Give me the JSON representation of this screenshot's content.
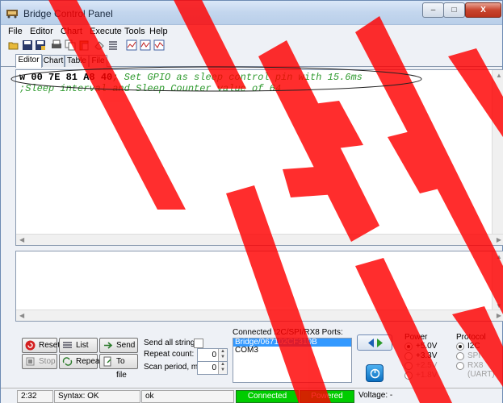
{
  "window": {
    "title": "Bridge Control Panel",
    "min_label": "–",
    "max_label": "□",
    "close_label": "X"
  },
  "menu": [
    {
      "label": "File"
    },
    {
      "label": "Editor"
    },
    {
      "label": "Chart"
    },
    {
      "label": "Execute"
    },
    {
      "label": "Tools"
    },
    {
      "label": "Help"
    }
  ],
  "toolbar": {
    "icons": [
      "open-icon",
      "save-icon",
      "save-as-icon",
      "print-icon",
      "copy-icon",
      "paste-icon",
      "clear-icon",
      "list-icon",
      "chart-1-icon",
      "chart-2-icon",
      "chart-3-icon"
    ]
  },
  "tabs": [
    {
      "label": "Editor",
      "active": true
    },
    {
      "label": "Chart"
    },
    {
      "label": "Table"
    },
    {
      "label": "File"
    }
  ],
  "editor": {
    "line1_cmd": "w 00 7E 81 A8 40",
    "line1_comment": "; Set GPIO as sleep control pin with 15.6ms",
    "line2_comment": ";Sleep interval and Sleep Counter value of 64"
  },
  "buttons": {
    "reset": "Reset",
    "list": "List",
    "send": "Send",
    "stop": "Stop",
    "repeat": "Repeat",
    "to_file": "To file"
  },
  "options": {
    "send_all_label": "Send all strings:",
    "repeat_count_label": "Repeat count:",
    "repeat_count_value": "0",
    "scan_period_label": "Scan period, ms:",
    "scan_period_value": "0"
  },
  "ports": {
    "label": "Connected I2C/SPI/RX8 Ports:",
    "items": [
      "Bridge/067102CF310B",
      "COM3"
    ]
  },
  "power": {
    "label": "Power",
    "options": [
      "+5.0V",
      "+3.3V",
      "+2.5V",
      "+1.8V"
    ],
    "selected": "+5.0V"
  },
  "protocol": {
    "label": "Protocol",
    "options": [
      "I2C",
      "SPI",
      "RX8 (UART)"
    ],
    "selected": "I2C"
  },
  "status": {
    "position": "2:32",
    "syntax": "Syntax: OK",
    "message": "ok",
    "connected": "Connected",
    "powered": "Powered",
    "voltage": "Voltage: -"
  },
  "colors": {
    "comment": "#2e9a2e",
    "status_green": "#00cc00",
    "watermark": "#ff0000",
    "selection": "#3399ff"
  }
}
